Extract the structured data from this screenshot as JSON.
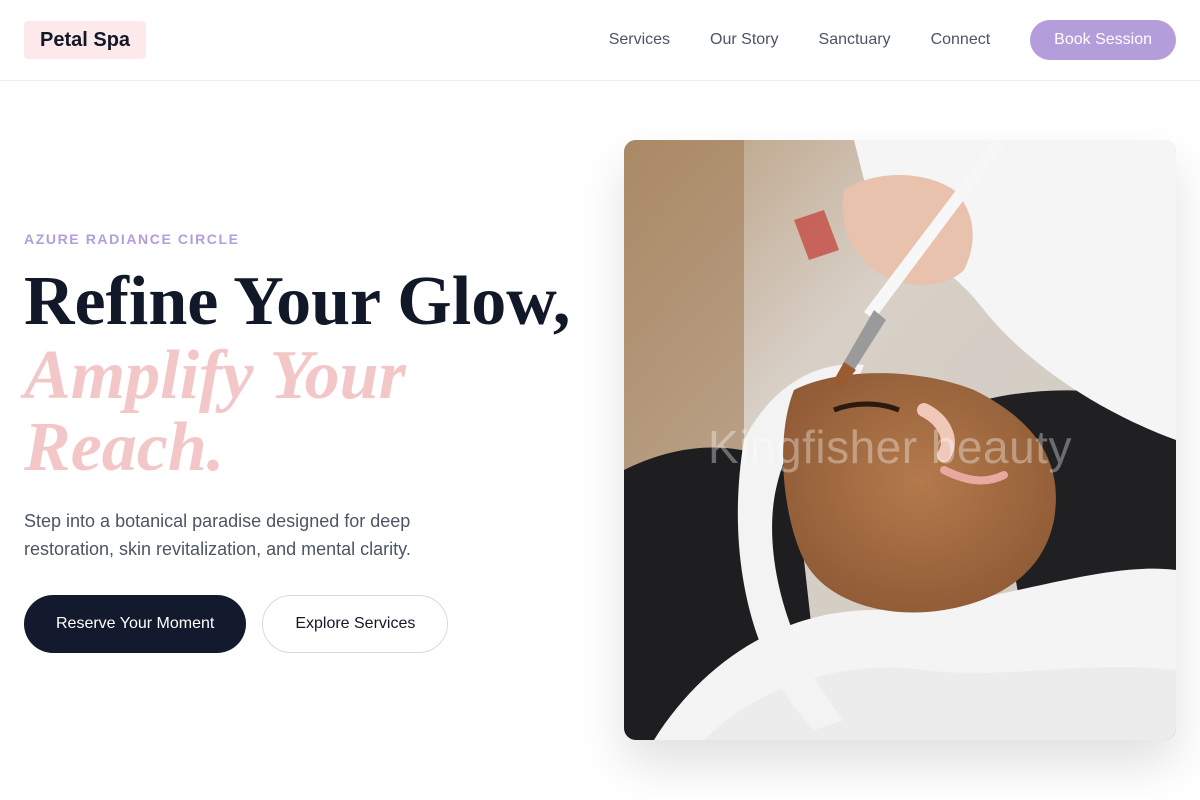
{
  "header": {
    "logo": "Petal Spa",
    "nav": [
      "Services",
      "Our Story",
      "Sanctuary",
      "Connect"
    ],
    "cta": "Book Session"
  },
  "hero": {
    "eyebrow": "AZURE RADIANCE CIRCLE",
    "headline_line1": "Refine Your Glow,",
    "headline_accent": "Amplify Your Reach.",
    "subcopy": "Step into a botanical paradise designed for deep restoration, skin revitalization, and mental clarity.",
    "primary_cta": "Reserve Your Moment",
    "secondary_cta": "Explore Services",
    "image_watermark": "Kingfisher beauty"
  },
  "colors": {
    "accent": "#b39ddb",
    "accent_soft": "#f3c7c7",
    "logo_bg": "#fde8ea",
    "dark": "#141a2e"
  }
}
